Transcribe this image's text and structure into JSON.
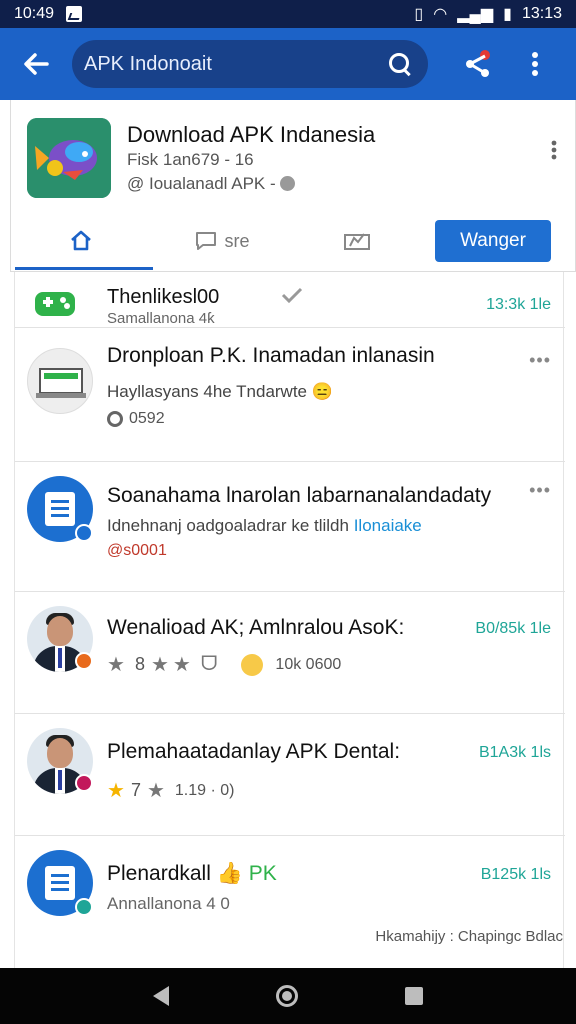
{
  "status_bar": {
    "time_left": "10:49",
    "time_right": "13:13"
  },
  "app_bar": {
    "back_icon": "arrow-left-icon",
    "search_value": "APK Indonoait",
    "search_icon": "search-icon",
    "share_icon": "share-icon",
    "more_icon": "more-vert-icon"
  },
  "app_header": {
    "title": "Download APK Indanesia",
    "subtitle_1": "Fisk 1an679 - 16",
    "subtitle_2": "@ Ioualanadl APK -",
    "tabs": [
      {
        "label": "",
        "icon": "home-icon"
      },
      {
        "label": "sre",
        "icon": "chat-icon"
      },
      {
        "label": "",
        "icon": "edit-icon"
      }
    ],
    "action_button": "Wanger"
  },
  "list": [
    {
      "title": "Thenlikesl00",
      "subtitle": "Samallanona 4ƙ",
      "size": "13:3k 1le",
      "icon": "gamepad-icon"
    },
    {
      "title": "Dronploan P.K. Inamadan inlanasin",
      "subtitle": "Hayllasyans 4he Tndarwte 😑",
      "meta": "0592",
      "icon": "laptop-icon"
    },
    {
      "title": "Soanahama lnarolan labarnanalandadaty",
      "subtitle": "Idnehnanj oadgoaladrar ke tlildh",
      "subtitle_link": "Ilonaiake",
      "meta": "@s0001",
      "icon": "document-icon"
    },
    {
      "title": "Wenalioad AK; Amlnralou AsoK:",
      "size": "B0/85k 1le",
      "rating_text": "8",
      "meta": "10k 0600",
      "icon": "person-avatar"
    },
    {
      "title": "Plemahaatadanlay APK Dental:",
      "size": "B1A3k 1ls",
      "rating_text": "7",
      "meta": "1.19 · 0)",
      "icon": "person-avatar"
    },
    {
      "title": "Plenardkall",
      "title_suffix": "PK",
      "subtitle": "Annallanona 4 0",
      "size": "B125k 1ls",
      "footer": "Hkamahijy : Chapingc Bdlac",
      "icon": "document-icon"
    }
  ],
  "colors": {
    "app_bar": "#1c62c7",
    "accent": "#1f6fd1",
    "size_text": "#1fa597",
    "link": "#1a8fd6",
    "meta_red": "#c0392b"
  }
}
